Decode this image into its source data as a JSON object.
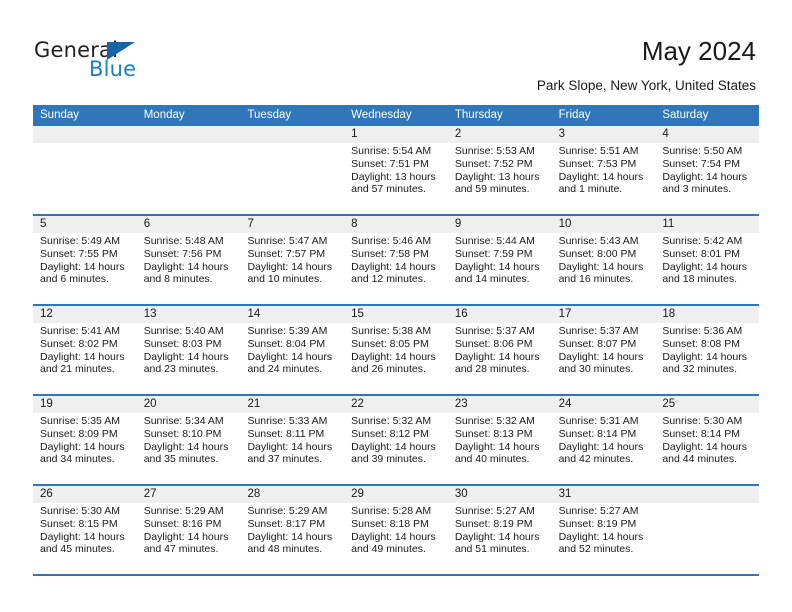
{
  "brand": {
    "word1": "General",
    "word2": "Blue",
    "triangle_color": "#1565a8",
    "blue_color": "#1c7fc4"
  },
  "header": {
    "title": "May 2024",
    "subtitle": "Park Slope, New York, United States"
  },
  "theme": {
    "header_bg": "#2f77b8",
    "row_divider": "#2f77b8",
    "daynum_bg": "#efefef"
  },
  "calendar": {
    "weekdays": [
      "Sunday",
      "Monday",
      "Tuesday",
      "Wednesday",
      "Thursday",
      "Friday",
      "Saturday"
    ],
    "weeks": [
      [
        {
          "day": "",
          "lines": []
        },
        {
          "day": "",
          "lines": []
        },
        {
          "day": "",
          "lines": []
        },
        {
          "day": "1",
          "lines": [
            "Sunrise: 5:54 AM",
            "Sunset: 7:51 PM",
            "Daylight: 13 hours",
            "and 57 minutes."
          ]
        },
        {
          "day": "2",
          "lines": [
            "Sunrise: 5:53 AM",
            "Sunset: 7:52 PM",
            "Daylight: 13 hours",
            "and 59 minutes."
          ]
        },
        {
          "day": "3",
          "lines": [
            "Sunrise: 5:51 AM",
            "Sunset: 7:53 PM",
            "Daylight: 14 hours",
            "and 1 minute."
          ]
        },
        {
          "day": "4",
          "lines": [
            "Sunrise: 5:50 AM",
            "Sunset: 7:54 PM",
            "Daylight: 14 hours",
            "and 3 minutes."
          ]
        }
      ],
      [
        {
          "day": "5",
          "lines": [
            "Sunrise: 5:49 AM",
            "Sunset: 7:55 PM",
            "Daylight: 14 hours",
            "and 6 minutes."
          ]
        },
        {
          "day": "6",
          "lines": [
            "Sunrise: 5:48 AM",
            "Sunset: 7:56 PM",
            "Daylight: 14 hours",
            "and 8 minutes."
          ]
        },
        {
          "day": "7",
          "lines": [
            "Sunrise: 5:47 AM",
            "Sunset: 7:57 PM",
            "Daylight: 14 hours",
            "and 10 minutes."
          ]
        },
        {
          "day": "8",
          "lines": [
            "Sunrise: 5:46 AM",
            "Sunset: 7:58 PM",
            "Daylight: 14 hours",
            "and 12 minutes."
          ]
        },
        {
          "day": "9",
          "lines": [
            "Sunrise: 5:44 AM",
            "Sunset: 7:59 PM",
            "Daylight: 14 hours",
            "and 14 minutes."
          ]
        },
        {
          "day": "10",
          "lines": [
            "Sunrise: 5:43 AM",
            "Sunset: 8:00 PM",
            "Daylight: 14 hours",
            "and 16 minutes."
          ]
        },
        {
          "day": "11",
          "lines": [
            "Sunrise: 5:42 AM",
            "Sunset: 8:01 PM",
            "Daylight: 14 hours",
            "and 18 minutes."
          ]
        }
      ],
      [
        {
          "day": "12",
          "lines": [
            "Sunrise: 5:41 AM",
            "Sunset: 8:02 PM",
            "Daylight: 14 hours",
            "and 21 minutes."
          ]
        },
        {
          "day": "13",
          "lines": [
            "Sunrise: 5:40 AM",
            "Sunset: 8:03 PM",
            "Daylight: 14 hours",
            "and 23 minutes."
          ]
        },
        {
          "day": "14",
          "lines": [
            "Sunrise: 5:39 AM",
            "Sunset: 8:04 PM",
            "Daylight: 14 hours",
            "and 24 minutes."
          ]
        },
        {
          "day": "15",
          "lines": [
            "Sunrise: 5:38 AM",
            "Sunset: 8:05 PM",
            "Daylight: 14 hours",
            "and 26 minutes."
          ]
        },
        {
          "day": "16",
          "lines": [
            "Sunrise: 5:37 AM",
            "Sunset: 8:06 PM",
            "Daylight: 14 hours",
            "and 28 minutes."
          ]
        },
        {
          "day": "17",
          "lines": [
            "Sunrise: 5:37 AM",
            "Sunset: 8:07 PM",
            "Daylight: 14 hours",
            "and 30 minutes."
          ]
        },
        {
          "day": "18",
          "lines": [
            "Sunrise: 5:36 AM",
            "Sunset: 8:08 PM",
            "Daylight: 14 hours",
            "and 32 minutes."
          ]
        }
      ],
      [
        {
          "day": "19",
          "lines": [
            "Sunrise: 5:35 AM",
            "Sunset: 8:09 PM",
            "Daylight: 14 hours",
            "and 34 minutes."
          ]
        },
        {
          "day": "20",
          "lines": [
            "Sunrise: 5:34 AM",
            "Sunset: 8:10 PM",
            "Daylight: 14 hours",
            "and 35 minutes."
          ]
        },
        {
          "day": "21",
          "lines": [
            "Sunrise: 5:33 AM",
            "Sunset: 8:11 PM",
            "Daylight: 14 hours",
            "and 37 minutes."
          ]
        },
        {
          "day": "22",
          "lines": [
            "Sunrise: 5:32 AM",
            "Sunset: 8:12 PM",
            "Daylight: 14 hours",
            "and 39 minutes."
          ]
        },
        {
          "day": "23",
          "lines": [
            "Sunrise: 5:32 AM",
            "Sunset: 8:13 PM",
            "Daylight: 14 hours",
            "and 40 minutes."
          ]
        },
        {
          "day": "24",
          "lines": [
            "Sunrise: 5:31 AM",
            "Sunset: 8:14 PM",
            "Daylight: 14 hours",
            "and 42 minutes."
          ]
        },
        {
          "day": "25",
          "lines": [
            "Sunrise: 5:30 AM",
            "Sunset: 8:14 PM",
            "Daylight: 14 hours",
            "and 44 minutes."
          ]
        }
      ],
      [
        {
          "day": "26",
          "lines": [
            "Sunrise: 5:30 AM",
            "Sunset: 8:15 PM",
            "Daylight: 14 hours",
            "and 45 minutes."
          ]
        },
        {
          "day": "27",
          "lines": [
            "Sunrise: 5:29 AM",
            "Sunset: 8:16 PM",
            "Daylight: 14 hours",
            "and 47 minutes."
          ]
        },
        {
          "day": "28",
          "lines": [
            "Sunrise: 5:29 AM",
            "Sunset: 8:17 PM",
            "Daylight: 14 hours",
            "and 48 minutes."
          ]
        },
        {
          "day": "29",
          "lines": [
            "Sunrise: 5:28 AM",
            "Sunset: 8:18 PM",
            "Daylight: 14 hours",
            "and 49 minutes."
          ]
        },
        {
          "day": "30",
          "lines": [
            "Sunrise: 5:27 AM",
            "Sunset: 8:19 PM",
            "Daylight: 14 hours",
            "and 51 minutes."
          ]
        },
        {
          "day": "31",
          "lines": [
            "Sunrise: 5:27 AM",
            "Sunset: 8:19 PM",
            "Daylight: 14 hours",
            "and 52 minutes."
          ]
        },
        {
          "day": "",
          "lines": []
        }
      ]
    ]
  }
}
